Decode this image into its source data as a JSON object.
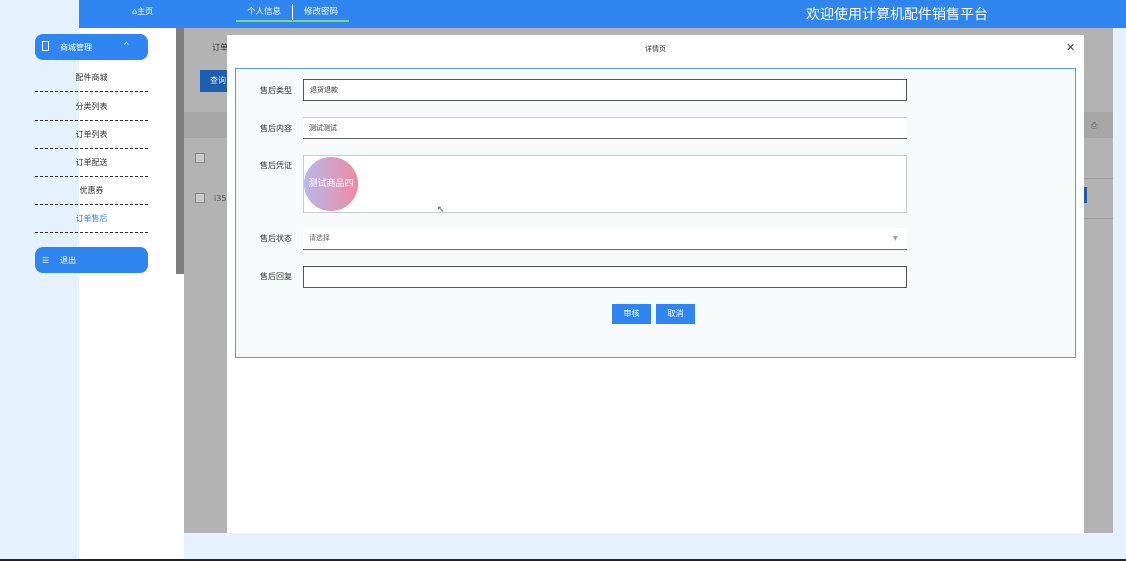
{
  "header": {
    "home_label": "⌂主页",
    "tabs": [
      "个人信息",
      "修改密码"
    ],
    "site_title": "欢迎使用计算机配件销售平台",
    "bar_color": "#2f86f0"
  },
  "sidebar": {
    "menu_group": {
      "label": "商城管理",
      "icon": "document-icon",
      "expanded_icon": "chevron-up-icon"
    },
    "items": [
      {
        "label": "配件商城",
        "active": false
      },
      {
        "label": "分类列表",
        "active": false
      },
      {
        "label": "订单列表",
        "active": false
      },
      {
        "label": "订单配送",
        "active": false
      },
      {
        "label": "优惠券",
        "active": false
      },
      {
        "label": "订单售后",
        "active": true
      }
    ],
    "logout": {
      "label": "退出",
      "icon": "list-icon"
    }
  },
  "background_page": {
    "partial_label": "订单",
    "partial_button": "查询",
    "partial_cell": "i35",
    "print_icon": "printer-icon"
  },
  "dialog": {
    "title": "详情页",
    "close_icon": "close-icon",
    "fields": {
      "type": {
        "label": "售后类型",
        "value": "退货退款"
      },
      "content": {
        "label": "售后内容",
        "value": "测试测试"
      },
      "proof": {
        "label": "售后凭证",
        "image_text": "测试商品四"
      },
      "status": {
        "label": "售后状态",
        "placeholder": "请选择"
      },
      "reply": {
        "label": "售后回复",
        "value": ""
      }
    },
    "buttons": {
      "audit": "审核",
      "cancel": "取消"
    }
  }
}
